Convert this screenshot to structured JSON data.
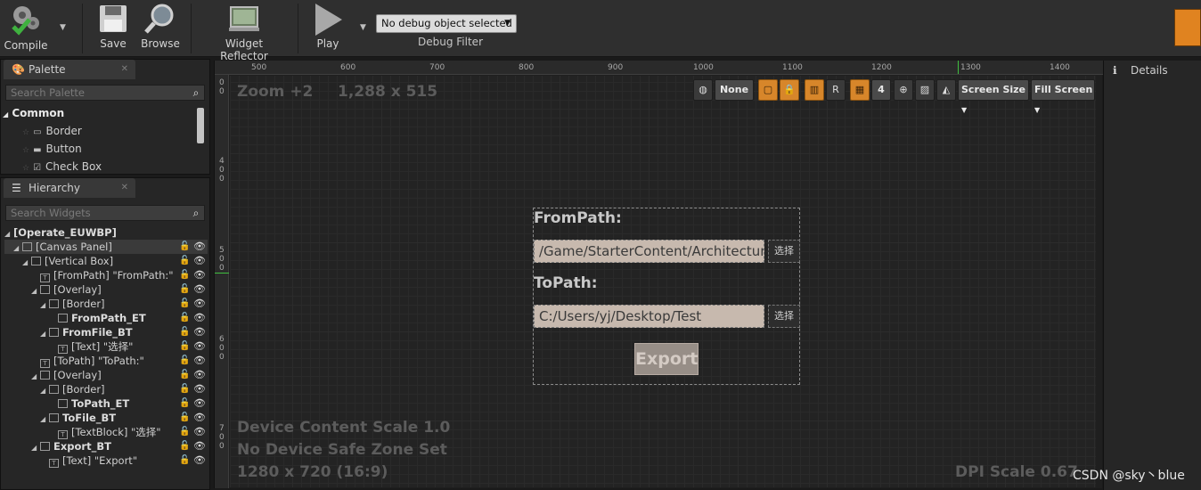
{
  "toolbar": {
    "compile_label": "Compile",
    "save_label": "Save",
    "browse_label": "Browse",
    "widget_reflector_label": "Widget Reflector",
    "play_label": "Play",
    "debug_object": "No debug object selected",
    "debug_filter_label": "Debug Filter"
  },
  "palette": {
    "tab": "Palette",
    "search_placeholder": "Search Palette",
    "category": "Common",
    "items": [
      {
        "label": "Border",
        "icon": "border-widget-icon"
      },
      {
        "label": "Button",
        "icon": "button-widget-icon"
      },
      {
        "label": "Check Box",
        "icon": "checkbox-widget-icon"
      }
    ]
  },
  "hierarchy": {
    "tab": "Hierarchy",
    "search_placeholder": "Search Widgets",
    "root": "[Operate_EUWBP]",
    "rows": [
      {
        "label": "[Canvas Panel]"
      },
      {
        "label": "[Vertical Box]"
      },
      {
        "label": "[FromPath] \"FromPath:\""
      },
      {
        "label": "[Overlay]"
      },
      {
        "label": "[Border]"
      },
      {
        "label": "FromPath_ET"
      },
      {
        "label": "FromFile_BT"
      },
      {
        "label": "[Text] \"选择\""
      },
      {
        "label": "[ToPath] \"ToPath:\""
      },
      {
        "label": "[Overlay]"
      },
      {
        "label": "[Border]"
      },
      {
        "label": "ToPath_ET"
      },
      {
        "label": "ToFile_BT"
      },
      {
        "label": "[TextBlock] \"选择\""
      },
      {
        "label": "Export_BT"
      },
      {
        "label": "[Text] \"Export\""
      }
    ]
  },
  "designer": {
    "zoom": "Zoom +2",
    "resolution": "1,288 x 515",
    "ruler_top": [
      "500",
      "600",
      "700",
      "800",
      "900",
      "1000",
      "1100",
      "1200",
      "1300",
      "1400"
    ],
    "ruler_left": [
      "0\n0",
      "4\n0\n0",
      "5\n0\n0",
      "6\n0\n0",
      "7\n0\n0"
    ],
    "toolbar": {
      "none_label": "None",
      "r_label": "R",
      "grid_snap": "4",
      "screen_size": "Screen Size",
      "fill_screen": "Fill Screen"
    },
    "device_scale": "Device Content Scale 1.0",
    "safe_zone": "No Device Safe Zone Set",
    "device_res": "1280 x 720 (16:9)",
    "dpi_scale": "DPI Scale 0.67"
  },
  "widget": {
    "from_label": "FromPath:",
    "from_value": "/Game/StarterContent/Architecture",
    "choose_label": "选择",
    "to_label": "ToPath:",
    "to_value": "C:/Users/yj/Desktop/Test",
    "choose_label_2": "选择",
    "export_label": "Export"
  },
  "details": {
    "tab": "Details"
  },
  "watermark": "CSDN @sky丶blue"
}
